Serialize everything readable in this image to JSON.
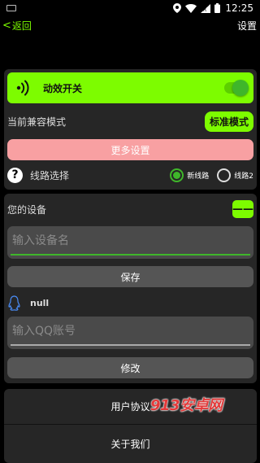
{
  "status_bar": {
    "time": "12:25",
    "icons": [
      "keyboard-icon",
      "location-icon",
      "wifi-icon",
      "signal-icon",
      "battery-icon"
    ]
  },
  "nav": {
    "back_label": "返回",
    "settings_label": "设置"
  },
  "effects": {
    "label": "动效开关",
    "enabled": true
  },
  "compat": {
    "label": "当前兼容模式",
    "mode_button": "标准模式"
  },
  "more_settings": {
    "label": "更多设置"
  },
  "route": {
    "label": "线路选择",
    "options": [
      "新线路",
      "线路2"
    ],
    "selected": "新线路"
  },
  "device": {
    "title": "您的设备",
    "collapse_label": "——",
    "name_placeholder": "输入设备名",
    "save_label": "保存",
    "qq_value": "null",
    "qq_placeholder": "输入QQ账号",
    "modify_label": "修改"
  },
  "footer_menu": {
    "items": [
      "用户协议",
      "关于我们"
    ]
  },
  "watermark": "913安卓网",
  "colors": {
    "accent": "#7dfc00",
    "toggle_on": "#3fb62a",
    "more_button": "#f8a0a2",
    "card_bg": "#262626",
    "qq_icon": "#4a8df8"
  }
}
